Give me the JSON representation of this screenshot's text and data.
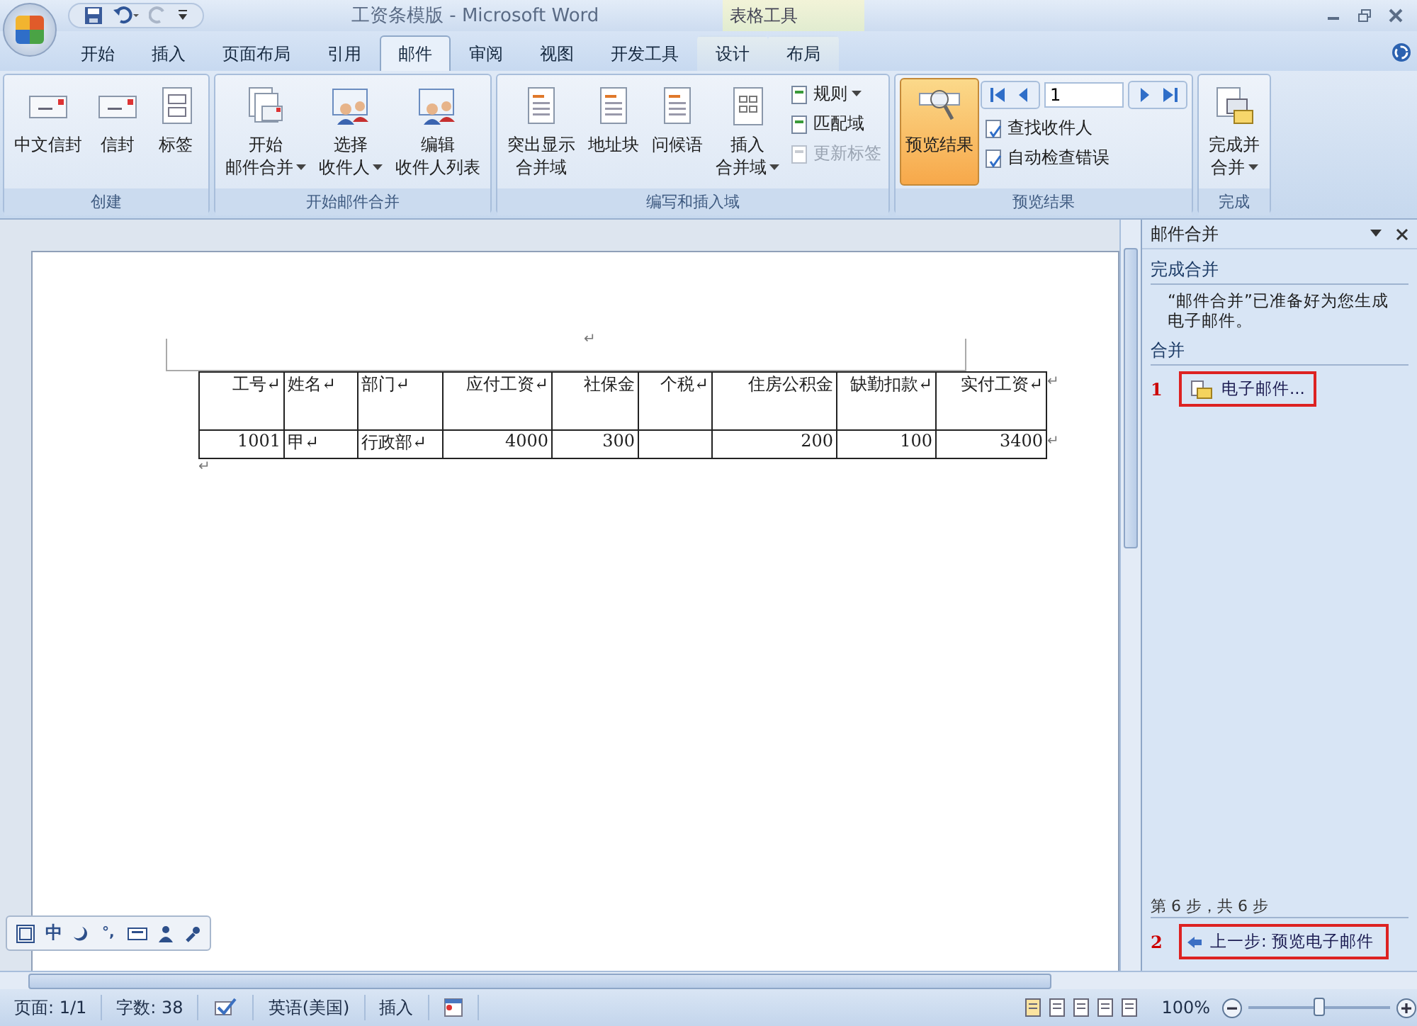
{
  "title_bar": {
    "title": "工资条模版 - Microsoft Word",
    "context_label": "表格工具"
  },
  "tabs": [
    {
      "label": "开始",
      "selected": false,
      "kind": "main"
    },
    {
      "label": "插入",
      "selected": false,
      "kind": "main"
    },
    {
      "label": "页面布局",
      "selected": false,
      "kind": "main"
    },
    {
      "label": "引用",
      "selected": false,
      "kind": "main"
    },
    {
      "label": "邮件",
      "selected": true,
      "kind": "main"
    },
    {
      "label": "审阅",
      "selected": false,
      "kind": "main"
    },
    {
      "label": "视图",
      "selected": false,
      "kind": "main"
    },
    {
      "label": "开发工具",
      "selected": false,
      "kind": "main"
    },
    {
      "label": "设计",
      "selected": false,
      "kind": "context"
    },
    {
      "label": "布局",
      "selected": false,
      "kind": "context"
    }
  ],
  "ribbon": [
    {
      "label": "创建",
      "items": [
        {
          "kind": "large",
          "lines": [
            "中文信封"
          ],
          "dropdown": false,
          "selected": false
        },
        {
          "kind": "large",
          "lines": [
            "信封"
          ],
          "dropdown": false,
          "selected": false
        },
        {
          "kind": "large",
          "lines": [
            "标签"
          ],
          "dropdown": false,
          "selected": false
        }
      ]
    },
    {
      "label": "开始邮件合并",
      "items": [
        {
          "kind": "large",
          "lines": [
            "开始",
            "邮件合并"
          ],
          "dropdown": true,
          "selected": false
        },
        {
          "kind": "large",
          "lines": [
            "选择",
            "收件人"
          ],
          "dropdown": true,
          "selected": false
        },
        {
          "kind": "large",
          "lines": [
            "编辑",
            "收件人列表"
          ],
          "dropdown": false,
          "selected": false
        }
      ]
    },
    {
      "label": "编写和插入域",
      "items": [
        {
          "kind": "large",
          "lines": [
            "突出显示",
            "合并域"
          ],
          "dropdown": false,
          "selected": false
        },
        {
          "kind": "large",
          "lines": [
            "地址块"
          ],
          "dropdown": false,
          "selected": false
        },
        {
          "kind": "large",
          "lines": [
            "问候语"
          ],
          "dropdown": false,
          "selected": false
        },
        {
          "kind": "large",
          "lines": [
            "插入",
            "合并域"
          ],
          "dropdown": true,
          "selected": false
        },
        {
          "kind": "stack",
          "items": [
            {
              "label": "规则",
              "dropdown": true,
              "disabled": false
            },
            {
              "label": "匹配域",
              "dropdown": false,
              "disabled": false
            },
            {
              "label": "更新标签",
              "dropdown": false,
              "disabled": true
            }
          ]
        }
      ]
    },
    {
      "label": "预览结果",
      "items": [
        {
          "kind": "large",
          "lines": [
            "预览结果"
          ],
          "dropdown": false,
          "selected": true
        },
        {
          "kind": "nav",
          "record": "1",
          "items": [
            {
              "label": "查找收件人",
              "dropdown": false,
              "disabled": false
            },
            {
              "label": "自动检查错误",
              "dropdown": false,
              "disabled": false
            }
          ]
        }
      ]
    },
    {
      "label": "完成",
      "items": [
        {
          "kind": "large",
          "lines": [
            "完成并",
            "合并"
          ],
          "dropdown": true,
          "selected": false
        }
      ]
    }
  ],
  "document": {
    "mark_above": "↵",
    "mark_below": "↵",
    "table": {
      "columns": [
        {
          "heading": "工号↵",
          "numeric": true
        },
        {
          "heading": "姓名↵",
          "numeric": false
        },
        {
          "heading": "部门↵",
          "numeric": false
        },
        {
          "heading": "应付工资↵",
          "numeric": true
        },
        {
          "heading": "社保金",
          "numeric": true
        },
        {
          "heading": "个税↵",
          "numeric": true
        },
        {
          "heading": "住房公积金",
          "numeric": true
        },
        {
          "heading": "缺勤扣款↵",
          "numeric": true
        },
        {
          "heading": "实付工资↵",
          "numeric": true
        }
      ],
      "row_end_mark": "↵",
      "rows": [
        [
          "1001",
          "甲↵",
          "行政部↵",
          "4000",
          "300",
          "",
          "200",
          "100",
          "3400"
        ]
      ]
    }
  },
  "ime_bar": {
    "mode": "中",
    "punctuation": "°,"
  },
  "task_pane": {
    "title": "邮件合并",
    "section": "完成合并",
    "message": "“邮件合并”已准备好为您生成电子邮件。",
    "merge_heading": "合并",
    "step_marker": "1",
    "merge_link": "电子邮件...",
    "step_text": "第 6 步，共 6 步",
    "back_marker": "2",
    "back_link": "上一步: 预览电子邮件"
  },
  "status_bar": {
    "page": "页面: 1/1",
    "words": "字数: 38",
    "language": "英语(美国)",
    "mode": "插入",
    "zoom": "100%",
    "zoom_slider": {
      "level": 0.5
    }
  }
}
